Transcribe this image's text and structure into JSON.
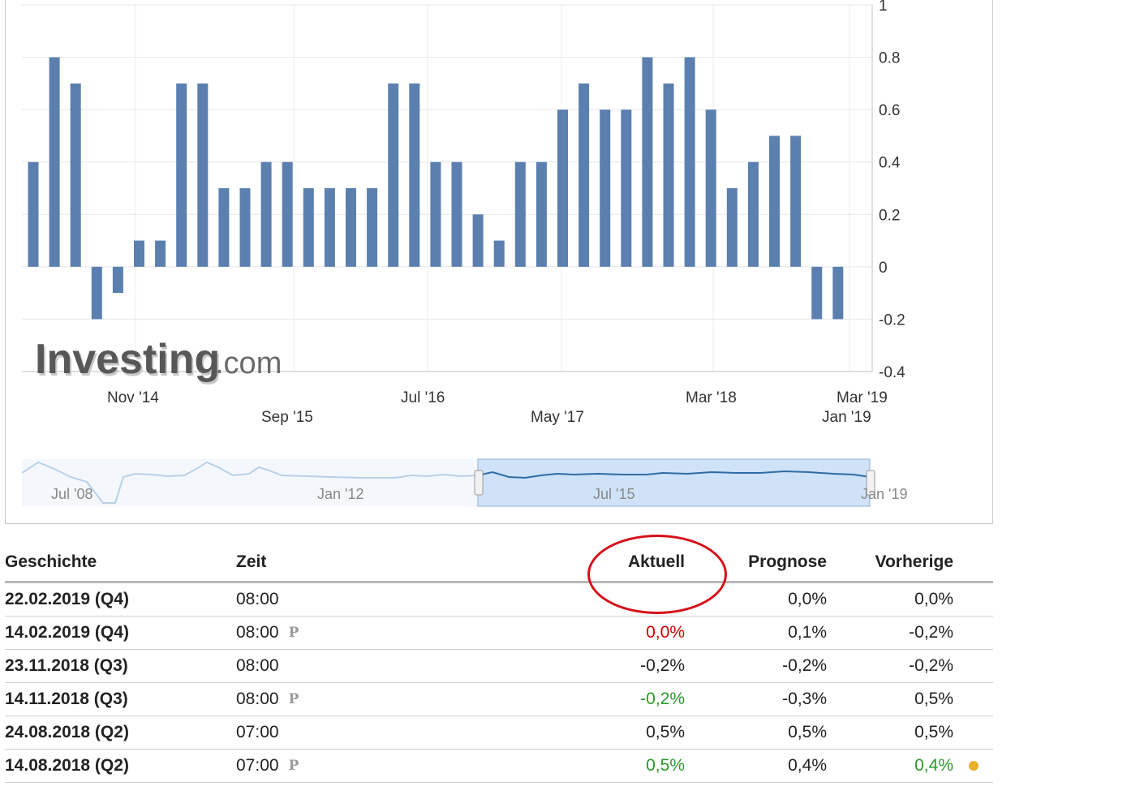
{
  "chart_data": {
    "type": "bar",
    "ylim": [
      -0.4,
      1
    ],
    "yticks": [
      "1",
      "0.8",
      "0.6",
      "0.4",
      "0.2",
      "0",
      "-0.2",
      "-0.4"
    ],
    "values": [
      0.4,
      0.8,
      0.7,
      -0.2,
      -0.1,
      0.1,
      0.1,
      0.7,
      0.7,
      0.3,
      0.3,
      0.4,
      0.4,
      0.3,
      0.3,
      0.3,
      0.3,
      0.7,
      0.7,
      0.4,
      0.4,
      0.2,
      0.1,
      0.4,
      0.4,
      0.6,
      0.7,
      0.6,
      0.6,
      0.8,
      0.7,
      0.8,
      0.6,
      0.3,
      0.4,
      0.5,
      0.5,
      -0.2,
      -0.2
    ],
    "xticks_row1": [
      "Nov '14",
      "Jul '16",
      "Mar '18",
      "Mar '19"
    ],
    "xticks_row2": [
      "Sep '15",
      "May '17",
      "Jan '19"
    ],
    "bar_color": "#5b80b0",
    "grid": true
  },
  "watermark": {
    "brand": "Investing",
    "suffix": ".com"
  },
  "navigator": {
    "labels": [
      "Jul '08",
      "Jan '12",
      "Jul '15",
      "Jan '19"
    ],
    "selection_color": "#cfe2f7",
    "line_color": "#2e6ca6"
  },
  "table": {
    "headers": {
      "history": "Geschichte",
      "time": "Zeit",
      "actual": "Aktuell",
      "forecast": "Prognose",
      "previous": "Vorherige"
    },
    "rows": [
      {
        "date": "22.02.2019 (Q4)",
        "time": "08:00",
        "prelim": "",
        "actual": "",
        "actual_color": "",
        "forecast": "0,0%",
        "previous": "0,0%",
        "previous_color": "",
        "dot": false
      },
      {
        "date": "14.02.2019 (Q4)",
        "time": "08:00",
        "prelim": "P",
        "actual": "0,0%",
        "actual_color": "red",
        "forecast": "0,1%",
        "previous": "-0,2%",
        "previous_color": "",
        "dot": false
      },
      {
        "date": "23.11.2018 (Q3)",
        "time": "08:00",
        "prelim": "",
        "actual": "-0,2%",
        "actual_color": "",
        "forecast": "-0,2%",
        "previous": "-0,2%",
        "previous_color": "",
        "dot": false
      },
      {
        "date": "14.11.2018 (Q3)",
        "time": "08:00",
        "prelim": "P",
        "actual": "-0,2%",
        "actual_color": "green",
        "forecast": "-0,3%",
        "previous": "0,5%",
        "previous_color": "",
        "dot": false
      },
      {
        "date": "24.08.2018 (Q2)",
        "time": "07:00",
        "prelim": "",
        "actual": "0,5%",
        "actual_color": "",
        "forecast": "0,5%",
        "previous": "0,5%",
        "previous_color": "",
        "dot": false
      },
      {
        "date": "14.08.2018 (Q2)",
        "time": "07:00",
        "prelim": "P",
        "actual": "0,5%",
        "actual_color": "green",
        "forecast": "0,4%",
        "previous": "0,4%",
        "previous_color": "green",
        "dot": true
      }
    ]
  }
}
